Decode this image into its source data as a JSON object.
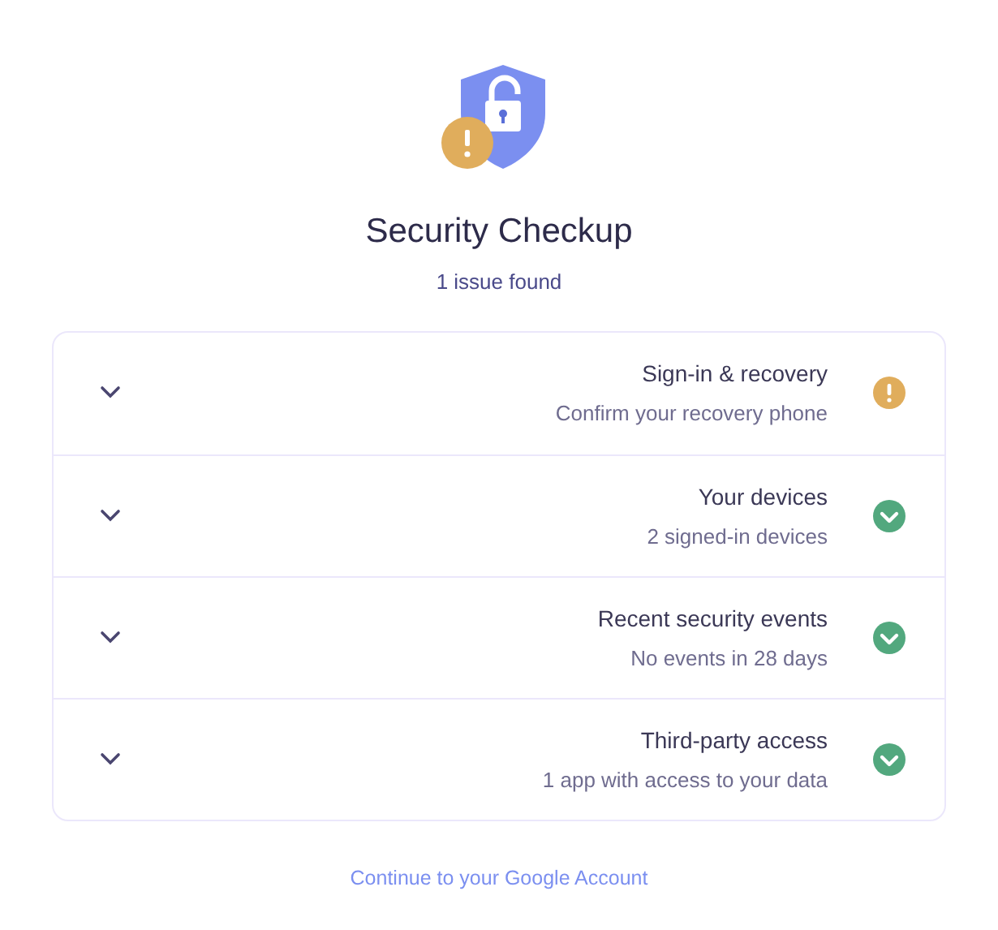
{
  "header": {
    "title": "Security Checkup",
    "subtitle": "1 issue found"
  },
  "items": [
    {
      "title": "Sign-in & recovery",
      "detail": "Confirm your recovery phone",
      "kind": "warning",
      "expanded": false
    },
    {
      "title": "Your devices",
      "detail": "2 signed-in devices",
      "kind": "ok",
      "expanded": false
    },
    {
      "title": "Recent security events",
      "detail": "No events in 28 days",
      "kind": "ok",
      "expanded": false
    },
    {
      "title": "Third-party access",
      "detail": "1 app with access to your data",
      "kind": "ok",
      "expanded": false
    }
  ],
  "link": "Continue to your Google Account"
}
